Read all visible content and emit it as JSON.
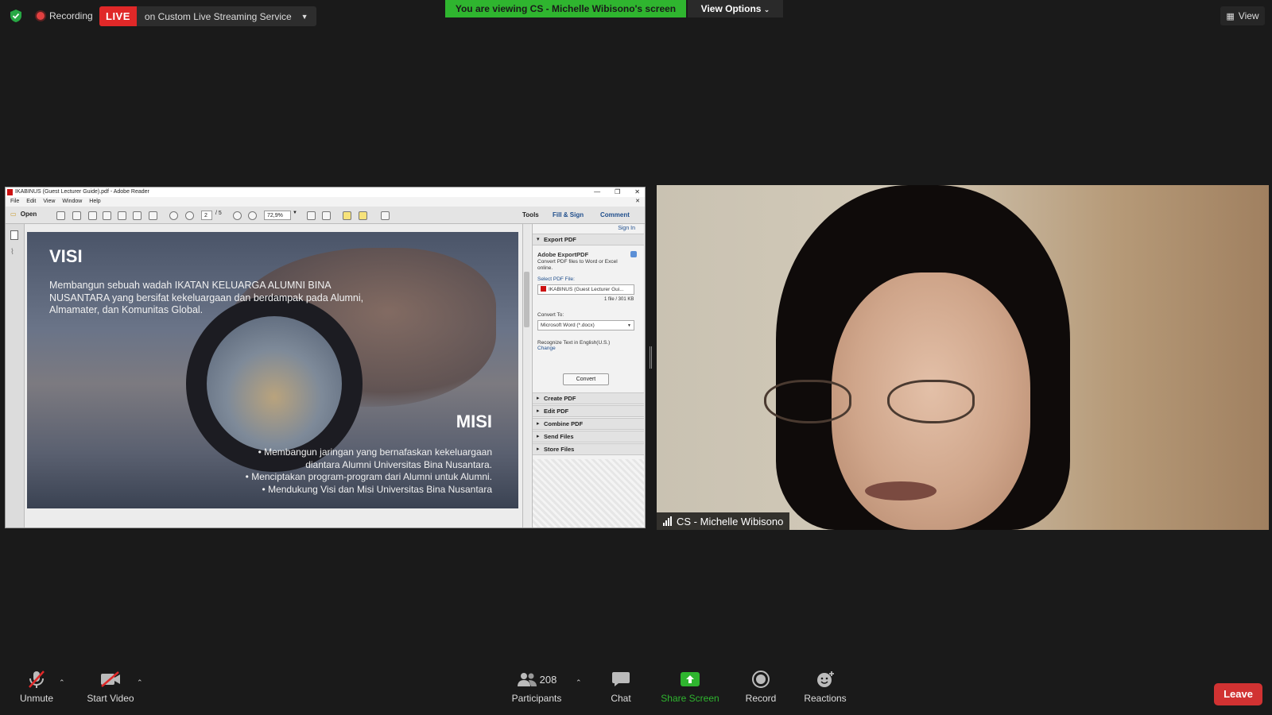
{
  "topbar": {
    "recording_label": "Recording",
    "live_label": "LIVE",
    "live_service": "on Custom Live Streaming Service",
    "viewing_banner": "You are viewing CS - Michelle Wibisono's screen",
    "view_options": "View Options",
    "view_button": "View",
    "colors": {
      "viewing_banner": "#2fb52f",
      "live": "#e02828"
    }
  },
  "reader": {
    "title": "IKABINUS (Guest Lecturer Guide).pdf - Adobe Reader",
    "menu": [
      "File",
      "Edit",
      "View",
      "Window",
      "Help"
    ],
    "toolbar": {
      "open": "Open",
      "page_current": "2",
      "page_total": "/ 5",
      "zoom": "72,9%",
      "tools": "Tools",
      "fill_sign": "Fill & Sign",
      "comment": "Comment"
    },
    "slide": {
      "visi_heading": "VISI",
      "visi_text": "Membangun sebuah wadah IKATAN KELUARGA ALUMNI BINA NUSANTARA yang bersifat kekeluargaan dan berdampak pada Alumni, Almamater, dan Komunitas Global.",
      "misi_heading": "MISI",
      "misi_lines": [
        "• Membangun jaringan yang bernafaskan kekeluargaan",
        "diantara Alumni Universitas Bina Nusantara.",
        "• Menciptakan program-program dari Alumni untuk Alumni.",
        "• Mendukung Visi dan Misi Universitas Bina Nusantara"
      ]
    },
    "pane": {
      "sign_in": "Sign In",
      "export_pdf": "Export PDF",
      "adobe_exportpdf": "Adobe ExportPDF",
      "convert_desc": "Convert PDF files to Word or Excel online.",
      "select_file_label": "Select PDF File:",
      "selected_file": "IKABINUS (Guest Lecturer Gui...",
      "file_count": "1 file / 301 KB",
      "convert_to_label": "Convert To:",
      "convert_to_value": "Microsoft Word (*.docx)",
      "recognize_text": "Recognize Text in English(U.S.)",
      "change": "Change",
      "convert_button": "Convert",
      "sections": [
        "Create PDF",
        "Edit PDF",
        "Combine PDF",
        "Send Files",
        "Store Files"
      ]
    }
  },
  "video": {
    "participant_name": "CS - Michelle Wibisono"
  },
  "bottombar": {
    "unmute": "Unmute",
    "start_video": "Start Video",
    "participants_count": "208",
    "participants": "Participants",
    "chat": "Chat",
    "share_screen": "Share Screen",
    "record": "Record",
    "reactions": "Reactions",
    "leave": "Leave",
    "colors": {
      "share": "#2fb52f",
      "leave": "#d13232"
    }
  }
}
